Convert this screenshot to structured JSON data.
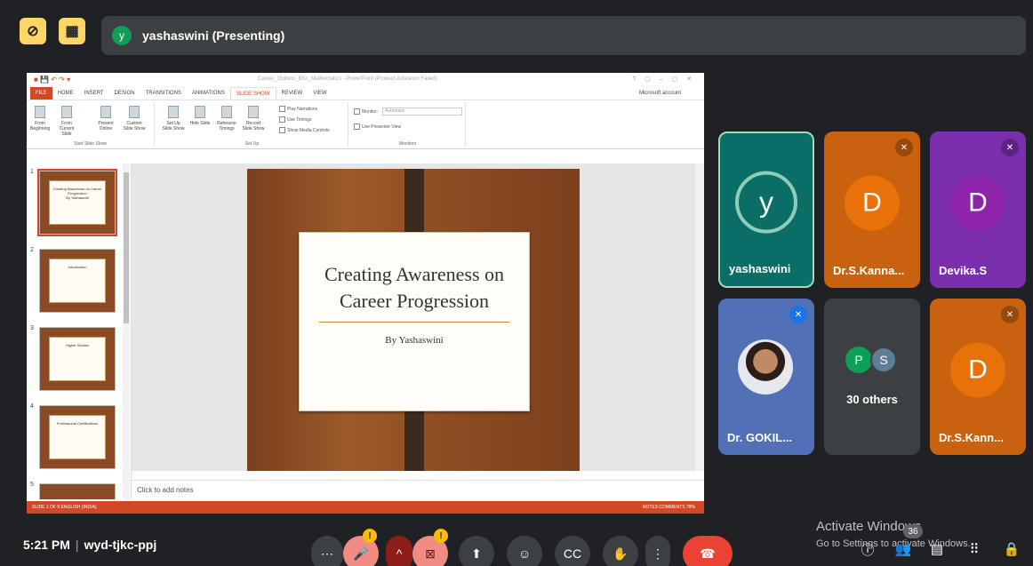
{
  "top_bar": {
    "presenter_initial": "y",
    "presenting_label": "yashaswini (Presenting)"
  },
  "ppt": {
    "window_title": "Career_Options_BSc_Mathematics - PowerPoint (Product Activation Failed)",
    "account": "Microsoft account",
    "tabs": [
      "FILE",
      "HOME",
      "INSERT",
      "DESIGN",
      "TRANSITIONS",
      "ANIMATIONS",
      "SLIDE SHOW",
      "REVIEW",
      "VIEW"
    ],
    "active_tab": "SLIDE SHOW",
    "ribbon": {
      "from_beginning": "From Beginning",
      "from_current": "From Current Slide",
      "present_online": "Present Online",
      "custom_show": "Custom Slide Show",
      "start_group": "Start Slide Show",
      "setup_show": "Set Up Slide Show",
      "hide_slide": "Hide Slide",
      "rehearse": "Rehearse Timings",
      "record": "Record Slide Show",
      "play_narrations": "Play Narrations",
      "use_timings": "Use Timings",
      "show_media": "Show Media Controls",
      "setup_group": "Set Up",
      "monitor_label": "Monitor:",
      "monitor_value": "Automatic",
      "presenter_view": "Use Presenter View",
      "monitors_group": "Monitors"
    },
    "thumbnails": [
      {
        "num": "1",
        "title": "Creating Awareness on Career Progression",
        "sub": "By Yashaswini"
      },
      {
        "num": "2",
        "title": "Introduction",
        "sub": ""
      },
      {
        "num": "3",
        "title": "Higher Studies",
        "sub": ""
      },
      {
        "num": "4",
        "title": "Professional Certifications",
        "sub": ""
      },
      {
        "num": "5",
        "title": "",
        "sub": ""
      }
    ],
    "slide": {
      "title_line1": "Creating Awareness on",
      "title_line2": "Career Progression",
      "byline": "By Yashaswini"
    },
    "notes_placeholder": "Click to add notes",
    "status_left": "SLIDE 1 OF 9    ENGLISH (INDIA)",
    "status_right": "NOTES   COMMENTS   78%"
  },
  "participants": [
    {
      "name": "yashaswini",
      "initial": "y",
      "muted": false
    },
    {
      "name": "Dr.S.Kanna...",
      "initial": "D",
      "muted": true
    },
    {
      "name": "Devika.S",
      "initial": "D",
      "muted": true
    },
    {
      "name": "Dr. GOKIL...",
      "initial": "",
      "muted": true
    },
    {
      "name": "30 others",
      "initial": "",
      "muted": false,
      "mini": [
        "P",
        "S"
      ]
    },
    {
      "name": "Dr.S.Kann...",
      "initial": "D",
      "muted": true
    }
  ],
  "bottom": {
    "time": "5:21 PM",
    "meeting_code": "wyd-tjkc-ppj",
    "warn_badge": "!",
    "activate_title": "Activate Windows",
    "activate_sub": "Go to Settings to activate Windows.",
    "people_count": "36"
  },
  "colors": {
    "bg": "#202124",
    "accent_yellow": "#fdd663",
    "end_call": "#ea4335",
    "ppt_accent": "#d24726"
  }
}
